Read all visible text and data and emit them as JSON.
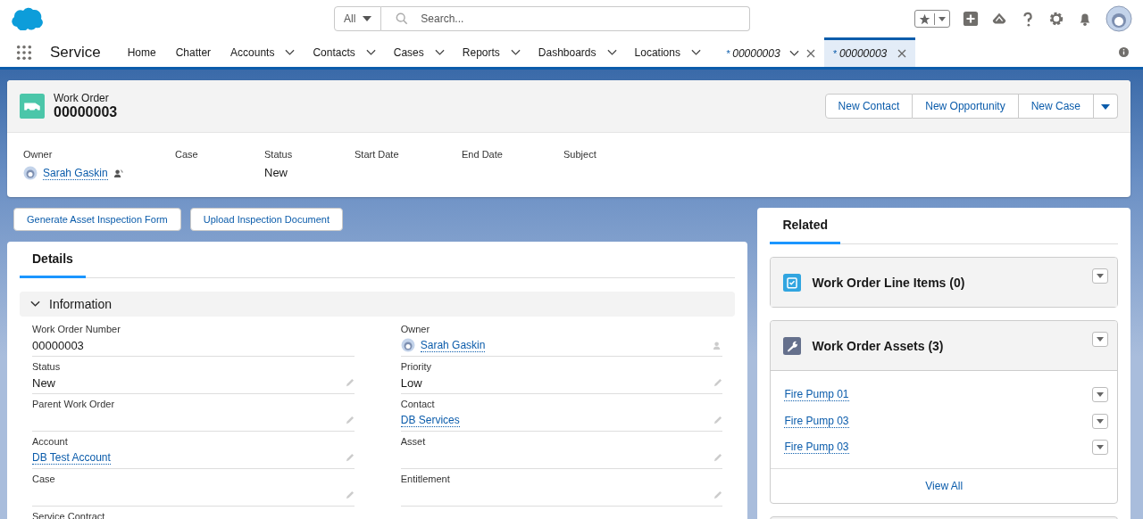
{
  "header": {
    "search_scope": "All",
    "search": {
      "placeholder": "Search..."
    }
  },
  "nav": {
    "app_name": "Service",
    "items": [
      {
        "label": "Home",
        "dropdown": false
      },
      {
        "label": "Chatter",
        "dropdown": false
      },
      {
        "label": "Accounts",
        "dropdown": true
      },
      {
        "label": "Contacts",
        "dropdown": true
      },
      {
        "label": "Cases",
        "dropdown": true
      },
      {
        "label": "Reports",
        "dropdown": true
      },
      {
        "label": "Dashboards",
        "dropdown": true
      },
      {
        "label": "Locations",
        "dropdown": true
      }
    ],
    "tabs": [
      {
        "mark": "*",
        "label": "00000003",
        "dropdown": true,
        "selected": false
      },
      {
        "mark": "*",
        "label": "00000003",
        "dropdown": false,
        "selected": true
      }
    ]
  },
  "record": {
    "type": "Work Order",
    "number": "00000003",
    "actions": [
      "New Contact",
      "New Opportunity",
      "New Case"
    ],
    "highlights": [
      {
        "label": "Owner",
        "kind": "user",
        "value": "Sarah Gaskin"
      },
      {
        "label": "Case",
        "kind": "text"
      },
      {
        "label": "Status",
        "kind": "text",
        "value": "New"
      },
      {
        "label": "Start Date",
        "kind": "text"
      },
      {
        "label": "End Date",
        "kind": "text"
      },
      {
        "label": "Subject",
        "kind": "text"
      }
    ]
  },
  "buttons": [
    "Generate Asset Inspection Form",
    "Upload Inspection Document"
  ],
  "details": {
    "tab": {
      "label": "Details",
      "selected": true
    },
    "section": {
      "title": "Information",
      "expanded": true
    },
    "left": [
      {
        "label": "Work Order Number",
        "kind": "text",
        "value": "00000003",
        "editable": false
      },
      {
        "label": "Status",
        "kind": "text",
        "value": "New",
        "editable": true
      },
      {
        "label": "Parent Work Order",
        "kind": "text",
        "editable": true
      },
      {
        "label": "Account",
        "kind": "link",
        "value": "DB Test Account",
        "editable": true
      },
      {
        "label": "Case",
        "kind": "text",
        "editable": true
      },
      {
        "label": "Service Contract",
        "kind": "text",
        "editable": false
      }
    ],
    "right": [
      {
        "label": "Owner",
        "kind": "user",
        "value": "Sarah Gaskin"
      },
      {
        "label": "Priority",
        "kind": "text",
        "value": "Low",
        "editable": true
      },
      {
        "label": "Contact",
        "kind": "link",
        "value": "DB Services",
        "editable": true
      },
      {
        "label": "Asset",
        "kind": "text",
        "editable": true
      },
      {
        "label": "Entitlement",
        "kind": "text",
        "editable": true
      }
    ]
  },
  "related": {
    "tab": {
      "label": "Related",
      "selected": true
    },
    "cards": [
      {
        "title": "Work Order Line Items (0)",
        "kind": "clipboard"
      },
      {
        "title": "Work Order Assets (3)",
        "kind": "wrench",
        "items": [
          "Fire Pump 01",
          "Fire Pump 03",
          "Fire Pump 03"
        ],
        "footer": "View All"
      }
    ]
  }
}
